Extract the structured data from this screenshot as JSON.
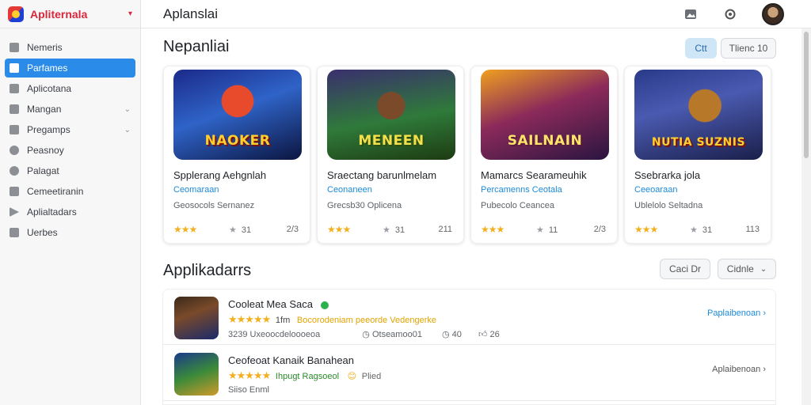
{
  "brand": {
    "name": "Apliternala",
    "caret": "▾"
  },
  "sidebar": {
    "items": [
      {
        "label": "Nemeris",
        "icon": "home-icon",
        "active": false,
        "chevron": ""
      },
      {
        "label": "Parfames",
        "icon": "apps-icon",
        "active": true,
        "chevron": ""
      },
      {
        "label": "Aplicotana",
        "icon": "grid-icon",
        "active": false,
        "chevron": ""
      },
      {
        "label": "Mangan",
        "icon": "mail-icon",
        "active": false,
        "chevron": "⌄"
      },
      {
        "label": "Pregamps",
        "icon": "box-icon",
        "active": false,
        "chevron": "⌄"
      },
      {
        "label": "Peasnoy",
        "icon": "circle-icon",
        "active": false,
        "chevron": ""
      },
      {
        "label": "Palagat",
        "icon": "pin-icon",
        "active": false,
        "chevron": ""
      },
      {
        "label": "Cemeetiranin",
        "icon": "tools-icon",
        "active": false,
        "chevron": ""
      },
      {
        "label": "Aplialtadars",
        "icon": "send-icon",
        "active": false,
        "chevron": ""
      },
      {
        "label": "Uerbes",
        "icon": "bars-icon",
        "active": false,
        "chevron": ""
      }
    ]
  },
  "header": {
    "title": "Aplanslai"
  },
  "section1": {
    "title": "Nepanliai",
    "btn_primary": "Ctt",
    "btn_secondary": "Tlienc 10"
  },
  "cards": [
    {
      "image_text": "NAOKER",
      "title": "Spplerang Aehgnlah",
      "sub": "Ceomaraan",
      "meta": "Geosocols Sernanez",
      "stars": "★★★",
      "rating": "31",
      "count": "2/3"
    },
    {
      "image_text": "MENEEN",
      "title": "Sraectang barunlmelam",
      "sub": "Ceonaneen",
      "meta": "Grecsb30 Oplicena",
      "stars": "★★★",
      "rating": "31",
      "count": "211"
    },
    {
      "image_text": "SAILNAIN",
      "title": "Mamarcs Searameuhik",
      "sub": "Percamenns Ceotala",
      "meta": "Pubecolo Ceancea",
      "stars": "★★★",
      "rating": "11",
      "count": "2/3"
    },
    {
      "image_text": "NUTIA SUZNIS",
      "title": "Ssebrarka jola",
      "sub": "Ceeoaraan",
      "meta": "Ublelolo Seltadna",
      "stars": "★★★",
      "rating": "31",
      "count": "113"
    }
  ],
  "section2": {
    "title": "Applikadarrs",
    "btn_left": "Caci Dr",
    "btn_right": "Cidnle"
  },
  "rows": [
    {
      "title": "Cooleat Mea Saca",
      "stars": "★★★★★",
      "rating_text": "1fm",
      "highlight": "Bocorodeniam peeorde Vedengerke",
      "line3": "3239 Uxeoocdeloooeoa",
      "stat1": "Otseamoo01",
      "stat2": "40",
      "stat3": "26",
      "action": "Paplaibenoan ›"
    },
    {
      "title": "Ceofeoat Kanaik Banahean",
      "stars": "★★★★★",
      "rating_text": "Ihpugt Ragsoeol",
      "highlight": "Plied",
      "line3": "Siiso Enml",
      "action": "Aplaibenoan ›"
    }
  ],
  "colors": {
    "accent": "#2b8be8",
    "brand": "#d6283b",
    "link": "#1e8ad8",
    "star": "#f2b01e"
  }
}
